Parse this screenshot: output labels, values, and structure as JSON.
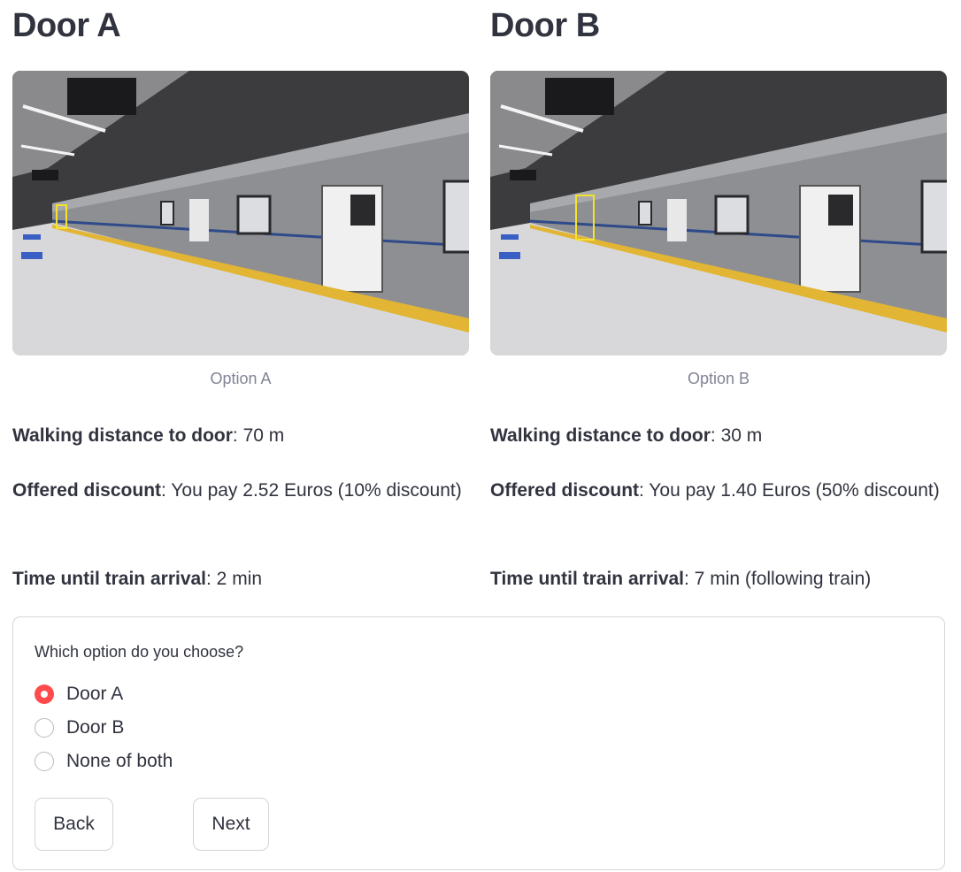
{
  "options": [
    {
      "title": "Door A",
      "image_caption": "Option A",
      "walk_label": "Walking distance to door",
      "walk_value": ": 70 m",
      "discount_label": "Offered discount",
      "discount_value": ": You pay 2.52 Euros (10% discount)",
      "arrival_label": "Time until train arrival",
      "arrival_value": ": 2 min"
    },
    {
      "title": "Door B",
      "image_caption": "Option B",
      "walk_label": "Walking distance to door",
      "walk_value": ": 30 m",
      "discount_label": "Offered discount",
      "discount_value": ": You pay 1.40 Euros (50% discount)",
      "arrival_label": "Time until train arrival",
      "arrival_value": ": 7 min (following train)"
    }
  ],
  "form": {
    "question": "Which option do you choose?",
    "choices": [
      "Door A",
      "Door B",
      "None of both"
    ],
    "selected": "Door A",
    "back_label": "Back",
    "next_label": "Next"
  },
  "colors": {
    "accent": "#ff4b4b",
    "text": "#31333f",
    "caption": "#808495",
    "highlight_box": "#f4e32a"
  },
  "icons": {
    "selected_radio": "radio-checked-icon",
    "unselected_radio": "radio-unchecked-icon"
  }
}
